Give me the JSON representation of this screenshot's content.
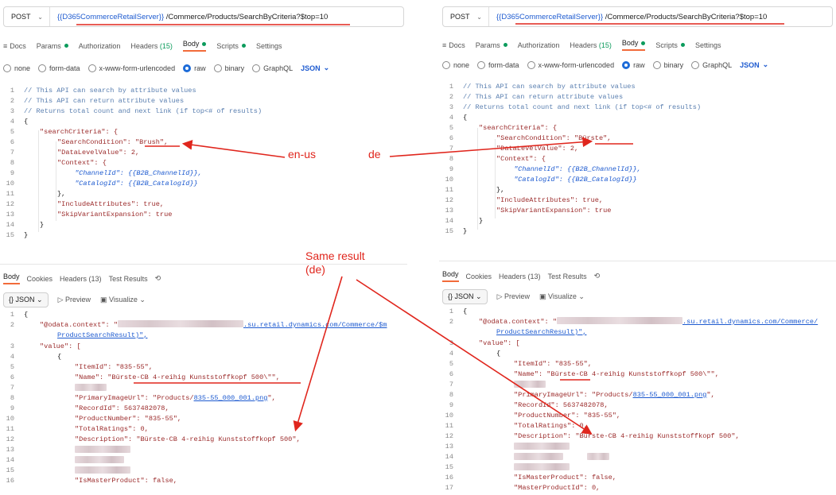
{
  "request": {
    "method": "POST",
    "url_var": "{{D365CommerceRetailServer}}",
    "url_path": "/Commerce/Products/SearchByCriteria?$top=10",
    "tabs": {
      "docs": "Docs",
      "params": "Params",
      "authorization": "Authorization",
      "headers": "Headers",
      "headers_count": "(15)",
      "body": "Body",
      "scripts": "Scripts",
      "settings": "Settings"
    },
    "body_types": {
      "none": "none",
      "form_data": "form-data",
      "urlencoded": "x-www-form-urlencoded",
      "raw": "raw",
      "binary": "binary",
      "graphql": "GraphQL",
      "json": "JSON"
    }
  },
  "left_request_lines": [
    "// This API can search by attribute values",
    "// This API can return attribute values",
    "// Returns total count and next link (if top<# of results)",
    "{",
    "\"searchCriteria\": {",
    "\"SearchCondition\": \"Brush\",",
    "\"DataLevelValue\": 2,",
    "\"Context\": {",
    "\"ChannelId\": {{B2B_ChannelId}},",
    "\"CatalogId\": {{B2B_CatalogId}}",
    "},",
    "\"IncludeAttributes\": true,",
    "\"SkipVariantExpansion\": true",
    "}",
    "}"
  ],
  "right_search_value": "\"Bürste\",",
  "response": {
    "tabs": {
      "body": "Body",
      "cookies": "Cookies",
      "headers": "Headers (13)",
      "test_results": "Test Results"
    },
    "format": "{} JSON",
    "preview": "Preview",
    "visualize": "Visualize",
    "odata_key": "\"@odata.context\": \"",
    "odata_domain_left": ".su.retail.dynamics.com/Commerce/$m",
    "odata_domain_right": ".su.retail.dynamics.com/Commerce/",
    "odata_tail": "ProductSearchResult)\",",
    "value_key": "\"value\": [",
    "item_id": "\"ItemId\": \"835-55\",",
    "name": "\"Name\": \"Bürste-CB 4-reihig Kunststoffkopf 500\\\"\",",
    "image_url_key": "\"PrimaryImageUrl\": \"Products/",
    "image_url_val": "835-55_000_001.png",
    "image_url_end": "\",",
    "record_id": "\"RecordId\": 5637482078,",
    "product_number": "\"ProductNumber\": \"835-55\",",
    "total_ratings": "\"TotalRatings\": 0,",
    "description": "\"Description\": \"Bürste-CB 4-reihig Kunststoffkopf 500\",",
    "is_master": "\"IsMasterProduct\": false,",
    "master_id": "\"MasterProductId\": 0,"
  },
  "annotations": {
    "en_us": "en-us",
    "de": "de",
    "same_result_1": "Same result",
    "same_result_2": "(de)"
  },
  "colors": {
    "annotation": "#e0261d",
    "active_tab_underline": "#f26b3a",
    "variable": "#1e5bd0",
    "green_dot": "#0c9b5c"
  }
}
